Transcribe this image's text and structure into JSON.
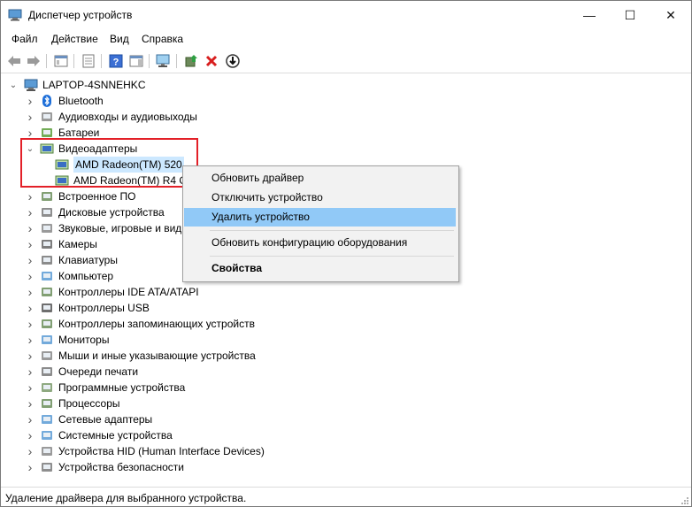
{
  "window": {
    "title": "Диспетчер устройств",
    "minimize": "—",
    "maximize": "☐",
    "close": "✕"
  },
  "menu": [
    "Файл",
    "Действие",
    "Вид",
    "Справка"
  ],
  "toolbar": {
    "icons": [
      "back-arrow-icon",
      "forward-arrow-icon",
      "show-hide-tree-icon",
      "properties-sheet-icon",
      "help-icon",
      "action-pane-icon",
      "monitor-scan-icon",
      "update-driver-icon",
      "uninstall-x-icon",
      "disable-device-icon"
    ]
  },
  "tree": {
    "root": "LAPTOP-4SNNEHKC",
    "items": [
      {
        "label": "Bluetooth",
        "icon": "bluetooth-icon",
        "expanded": false
      },
      {
        "label": "Аудиовходы и аудиовыходы",
        "icon": "audio-io-icon",
        "expanded": false
      },
      {
        "label": "Батареи",
        "icon": "battery-icon",
        "expanded": false
      },
      {
        "label": "Видеоадаптеры",
        "icon": "display-adapter-icon",
        "expanded": true
      },
      {
        "label": "AMD Radeon(TM) 520",
        "icon": "gpu-icon",
        "child": true,
        "selected": true
      },
      {
        "label": "AMD Radeon(TM) R4 G",
        "icon": "gpu-icon",
        "child": true
      },
      {
        "label": "Встроенное ПО",
        "icon": "firmware-icon",
        "expanded": false
      },
      {
        "label": "Дисковые устройства",
        "icon": "disk-drive-icon",
        "expanded": false
      },
      {
        "label": "Звуковые, игровые и вид",
        "icon": "speaker-icon",
        "expanded": false
      },
      {
        "label": "Камеры",
        "icon": "camera-icon",
        "expanded": false
      },
      {
        "label": "Клавиатуры",
        "icon": "keyboard-icon",
        "expanded": false
      },
      {
        "label": "Компьютер",
        "icon": "computer-icon",
        "expanded": false
      },
      {
        "label": "Контроллеры IDE ATA/ATAPI",
        "icon": "ide-controller-icon",
        "expanded": false
      },
      {
        "label": "Контроллеры USB",
        "icon": "usb-icon",
        "expanded": false
      },
      {
        "label": "Контроллеры запоминающих устройств",
        "icon": "storage-controller-icon",
        "expanded": false
      },
      {
        "label": "Мониторы",
        "icon": "monitor-icon",
        "expanded": false
      },
      {
        "label": "Мыши и иные указывающие устройства",
        "icon": "mouse-icon",
        "expanded": false
      },
      {
        "label": "Очереди печати",
        "icon": "printer-icon",
        "expanded": false
      },
      {
        "label": "Программные устройства",
        "icon": "software-device-icon",
        "expanded": false
      },
      {
        "label": "Процессоры",
        "icon": "processor-icon",
        "expanded": false
      },
      {
        "label": "Сетевые адаптеры",
        "icon": "network-adapter-icon",
        "expanded": false
      },
      {
        "label": "Системные устройства",
        "icon": "system-device-icon",
        "expanded": false
      },
      {
        "label": "Устройства HID (Human Interface Devices)",
        "icon": "hid-icon",
        "expanded": false
      },
      {
        "label": "Устройства безопасности",
        "icon": "security-device-icon",
        "expanded": false
      }
    ]
  },
  "context_menu": {
    "items": [
      {
        "label": "Обновить драйвер"
      },
      {
        "label": "Отключить устройство"
      },
      {
        "label": "Удалить устройство",
        "highlighted": true
      },
      {
        "label": "Обновить конфигурацию оборудования"
      },
      {
        "label": "Свойства",
        "bold": true
      }
    ]
  },
  "status": {
    "text": "Удаление драйвера для выбранного устройства."
  },
  "colors": {
    "selection": "#cce8ff",
    "menu_highlight": "#91c9f7",
    "annotation_box": "#e32028"
  }
}
